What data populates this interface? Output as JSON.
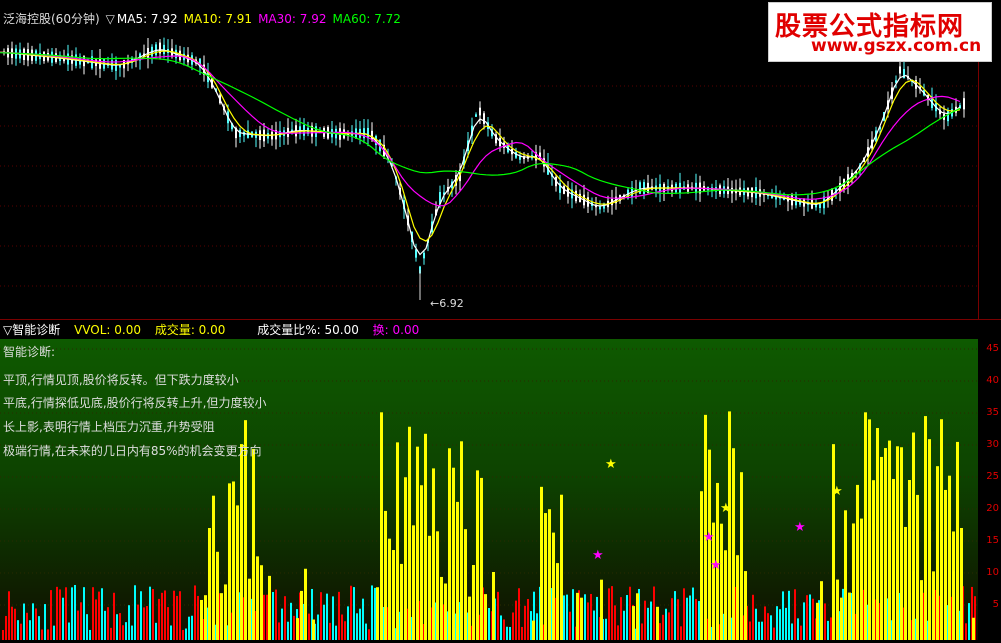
{
  "window": {
    "title": "泛海控股(60分钟)"
  },
  "watermark": {
    "title": "股票公式指标网",
    "url": "www.gszx.com.cn"
  },
  "price_panel": {
    "legend_prefix": "▽",
    "ma": [
      {
        "label": "MA5: 7.92",
        "color": "#ffffff"
      },
      {
        "label": "MA10: 7.91",
        "color": "#ffff00"
      },
      {
        "label": "MA30: 7.92",
        "color": "#ff00ff"
      },
      {
        "label": "MA60: 7.72",
        "color": "#00ff00"
      }
    ],
    "low_marker": "6.92"
  },
  "indicator_panel": {
    "header": [
      {
        "label": "▽智能诊断",
        "color": "#ffffff"
      },
      {
        "label": "VVOL: 0.00",
        "color": "#ffff00"
      },
      {
        "label": "成交量: 0.00",
        "color": "#ffff00"
      },
      {
        "label": "成交量比%: 50.00",
        "color": "#ffffff"
      },
      {
        "label": "换: 0.00",
        "color": "#ff00ff"
      }
    ],
    "diagnosis": [
      {
        "text": "智能诊断:",
        "color": "#ffffff"
      },
      {
        "text": "平顶,行情见顶,股价将反转。但下跌力度较小",
        "color": "#ffffff"
      },
      {
        "text": "平底,行情探低见底,股价行将反转上升,但力度较小",
        "color": "#ffffff"
      },
      {
        "text": "长上影,表明行情上档压力沉重,升势受阻",
        "color": "#00ffff"
      },
      {
        "text": "极端行情,在未来的几日内有85%的机会变更方向",
        "color": "#ffffff"
      }
    ],
    "y_ticks": [
      "45",
      "40",
      "35",
      "30",
      "25",
      "20",
      "15",
      "10",
      "5"
    ]
  },
  "colors": {
    "frame": "#7a0000",
    "yellow_bar": "#ffff00",
    "cyan_bar": "#00ffff",
    "red_bar": "#ff0000"
  }
}
